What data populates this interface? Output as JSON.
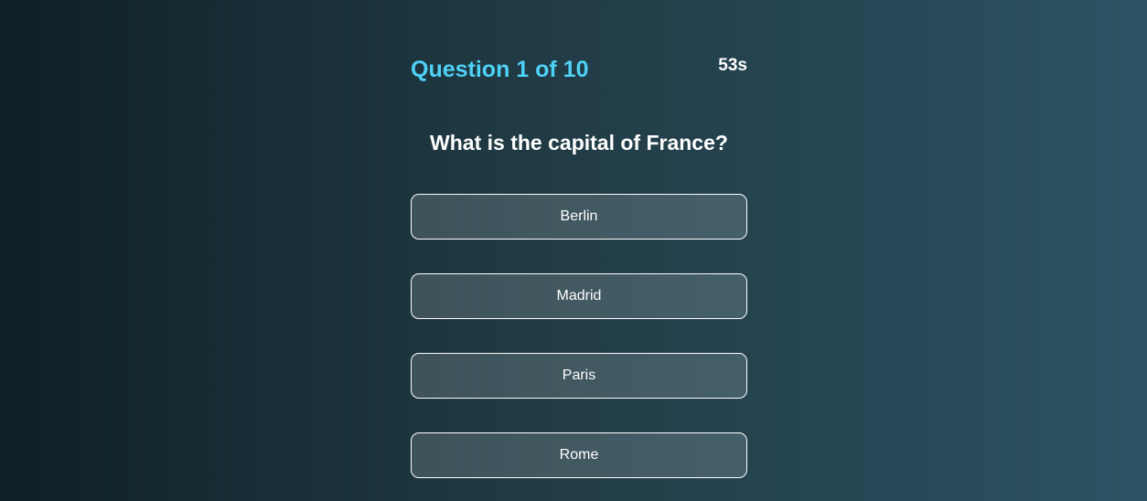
{
  "header": {
    "question_counter": "Question 1 of 10",
    "timer": "53s"
  },
  "question": {
    "text": "What is the capital of France?"
  },
  "options": [
    {
      "label": "Berlin"
    },
    {
      "label": "Madrid"
    },
    {
      "label": "Paris"
    },
    {
      "label": "Rome"
    }
  ],
  "colors": {
    "accent": "#4fd1f5",
    "background_start": "#0f2027",
    "background_end": "#2c5364"
  }
}
